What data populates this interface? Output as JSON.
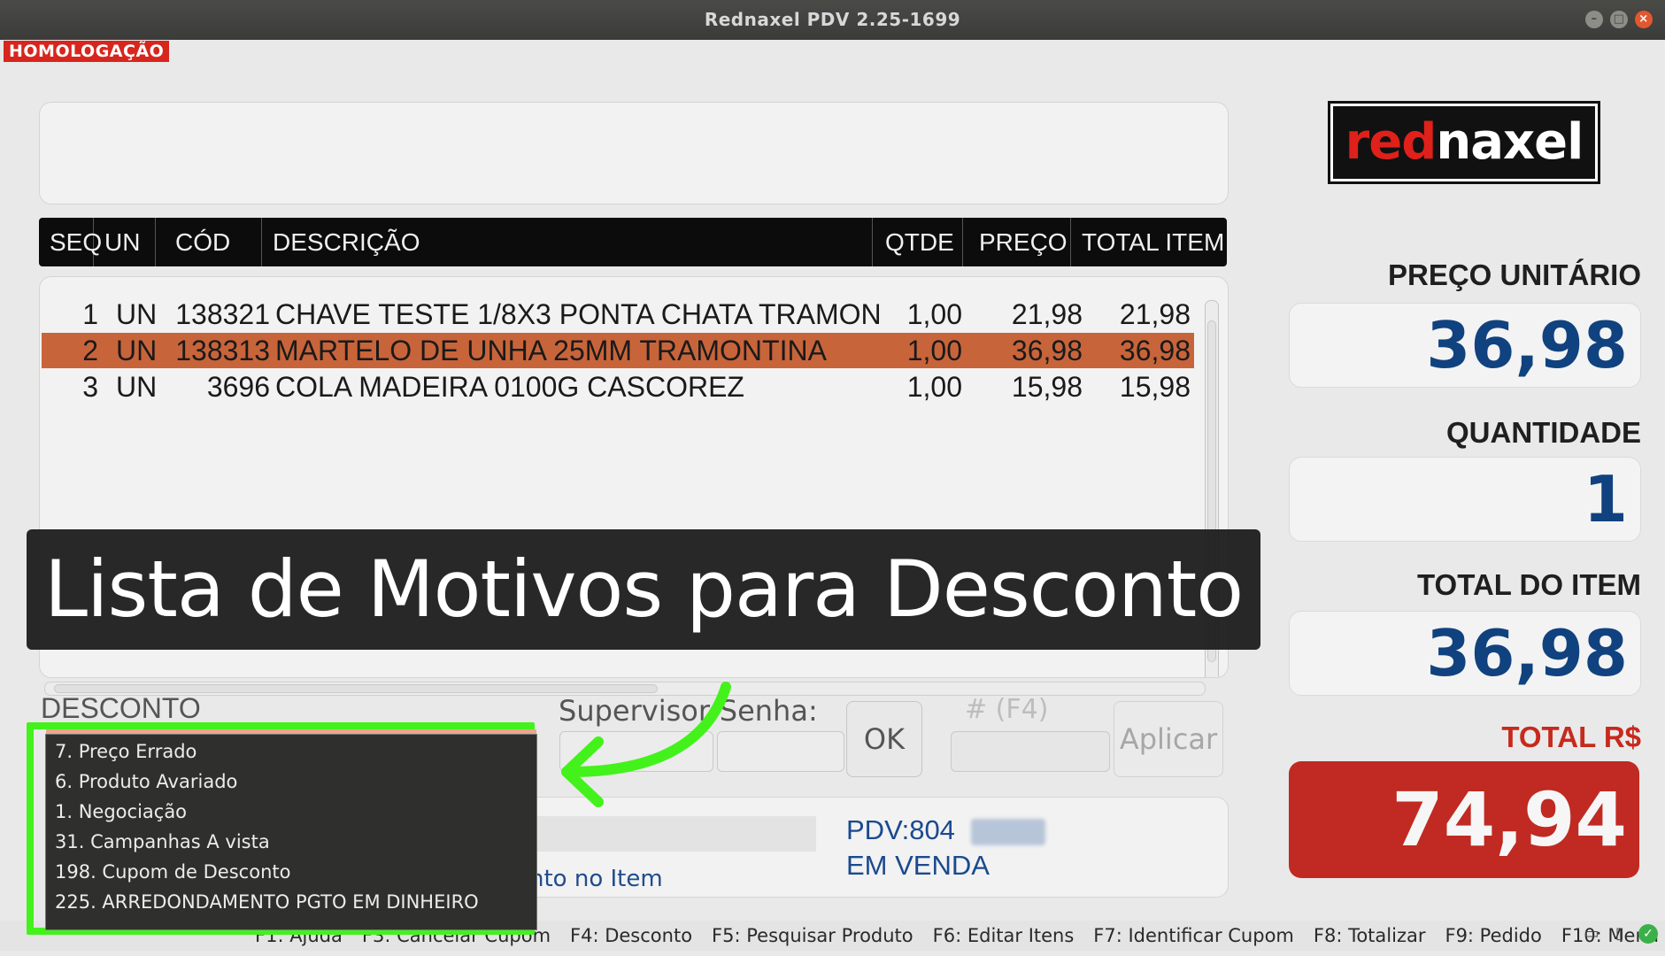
{
  "window": {
    "title": "Rednaxel PDV 2.25-1699"
  },
  "environment_badge": "HOMOLOGAÇÃO",
  "table": {
    "headers": [
      "SEQ",
      "UN",
      "CÓD",
      "DESCRIÇÃO",
      "QTDE",
      "PREÇO",
      "TOTAL ITEM"
    ],
    "rows": [
      {
        "seq": "1",
        "un": "UN",
        "cod": "138321",
        "desc": "CHAVE TESTE 1/8X3 PONTA CHATA TRAMON",
        "qtde": "1,00",
        "preco": "21,98",
        "total": "21,98",
        "selected": false
      },
      {
        "seq": "2",
        "un": "UN",
        "cod": "138313",
        "desc": "MARTELO DE UNHA 25MM TRAMONTINA",
        "qtde": "1,00",
        "preco": "36,98",
        "total": "36,98",
        "selected": true
      },
      {
        "seq": "3",
        "un": "UN",
        "cod": "3696",
        "desc": "COLA MADEIRA 0100G CASCOREZ",
        "qtde": "1,00",
        "preco": "15,98",
        "total": "15,98",
        "selected": false
      }
    ]
  },
  "discount": {
    "label": "DESCONTO",
    "supervisor_label": "Supervisor/Senha:",
    "ok_label": "OK",
    "f4_label": "#   (F4)",
    "apply_label": "Aplicar",
    "reasons": [
      "7. Preço Errado",
      "6. Produto Avariado",
      "1. Negociação",
      "31. Campanhas A vista",
      "198. Cupom de Desconto",
      "225. ARREDONDAMENTO PGTO EM DINHEIRO"
    ]
  },
  "status": {
    "partial_text": "nto no Item",
    "pdv": "PDV:804",
    "state": "EM VENDA"
  },
  "logo": {
    "part1": "red",
    "part2": "naxel"
  },
  "right_panel": {
    "unit_price_label": "PREÇO UNITÁRIO",
    "unit_price": "36,98",
    "quantity_label": "QUANTIDADE",
    "quantity": "1",
    "item_total_label": "TOTAL DO ITEM",
    "item_total": "36,98",
    "total_label": "TOTAL R$",
    "total": "74,94"
  },
  "statusbar": {
    "fkeys": [
      "F1: Ajuda",
      "F3: Cancelar Cupom",
      "F4: Desconto",
      "F5: Pesquisar Produto",
      "F6: Editar Itens",
      "F7: Identificar Cupom",
      "F8: Totalizar",
      "F9: Pedido",
      "F10: Menu"
    ]
  },
  "overlay": {
    "caption": "Lista de Motivos para Desconto"
  },
  "colors": {
    "highlight_row": "#c8643a",
    "total_bg": "#c02a22",
    "annotation": "#43f21b",
    "value_blue": "#10427f"
  }
}
